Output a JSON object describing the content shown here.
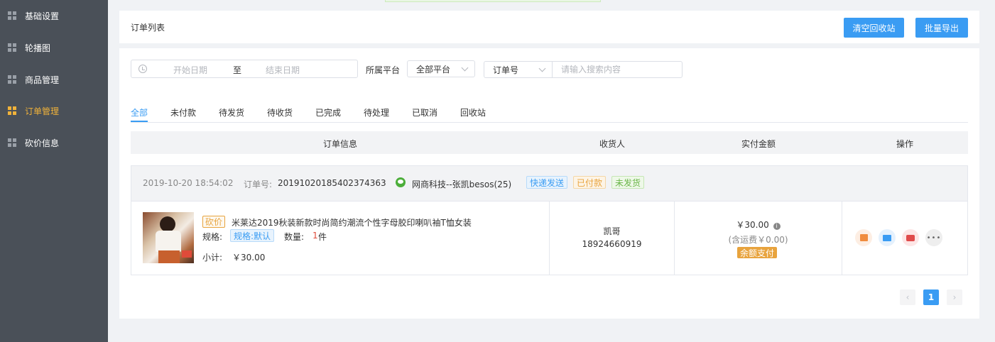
{
  "sidebar": {
    "items": [
      {
        "label": "基础设置",
        "icon": "grid-icon",
        "active": false
      },
      {
        "label": "轮播图",
        "icon": "grid-icon",
        "active": false
      },
      {
        "label": "商品管理",
        "icon": "grid-icon",
        "active": false
      },
      {
        "label": "订单管理",
        "icon": "grid-icon",
        "active": true
      },
      {
        "label": "砍价信息",
        "icon": "grid-icon",
        "active": false
      }
    ]
  },
  "header": {
    "title": "订单列表",
    "clear_recycle_label": "清空回收站",
    "batch_export_label": "批量导出"
  },
  "filters": {
    "start_placeholder": "开始日期",
    "range_sep": "至",
    "end_placeholder": "结束日期",
    "platform_label": "所属平台",
    "platform_value": "全部平台",
    "search_field_value": "订单号",
    "search_placeholder": "请输入搜索内容"
  },
  "tabs": [
    "全部",
    "未付款",
    "待发货",
    "待收货",
    "已完成",
    "待处理",
    "已取消",
    "回收站"
  ],
  "active_tab": "全部",
  "table": {
    "headers": [
      "订单信息",
      "收货人",
      "实付金额",
      "操作"
    ]
  },
  "order": {
    "time": "2019-10-20 18:54:02",
    "order_no_label": "订单号:",
    "order_no": "20191020185402374363",
    "shop": "网商科技--张凯besos(25)",
    "tags": [
      "快递发送",
      "已付款",
      "未发货"
    ],
    "kanjia_tag": "砍价",
    "product_name": "米莱达2019秋装新款时尚简约潮流个性字母胶印喇叭袖T恤女装",
    "spec_label": "规格:",
    "spec_value": "规格:默认",
    "qty_label": "数量:",
    "qty_value": "1",
    "qty_unit": "件",
    "subtotal_label": "小计:",
    "subtotal_value": "￥30.00",
    "receiver_name": "凯哥",
    "receiver_phone": "18924660919",
    "paid_amount": "￥30.00",
    "info_icon": "i",
    "freight": "(含运费￥0.00)",
    "pay_method": "余额支付"
  },
  "pager": {
    "prev": "‹",
    "current": "1",
    "next": "›"
  },
  "colors": {
    "sidebar_bg": "#4a5058",
    "active": "#f0b23a",
    "primary": "#3a9cf3"
  }
}
